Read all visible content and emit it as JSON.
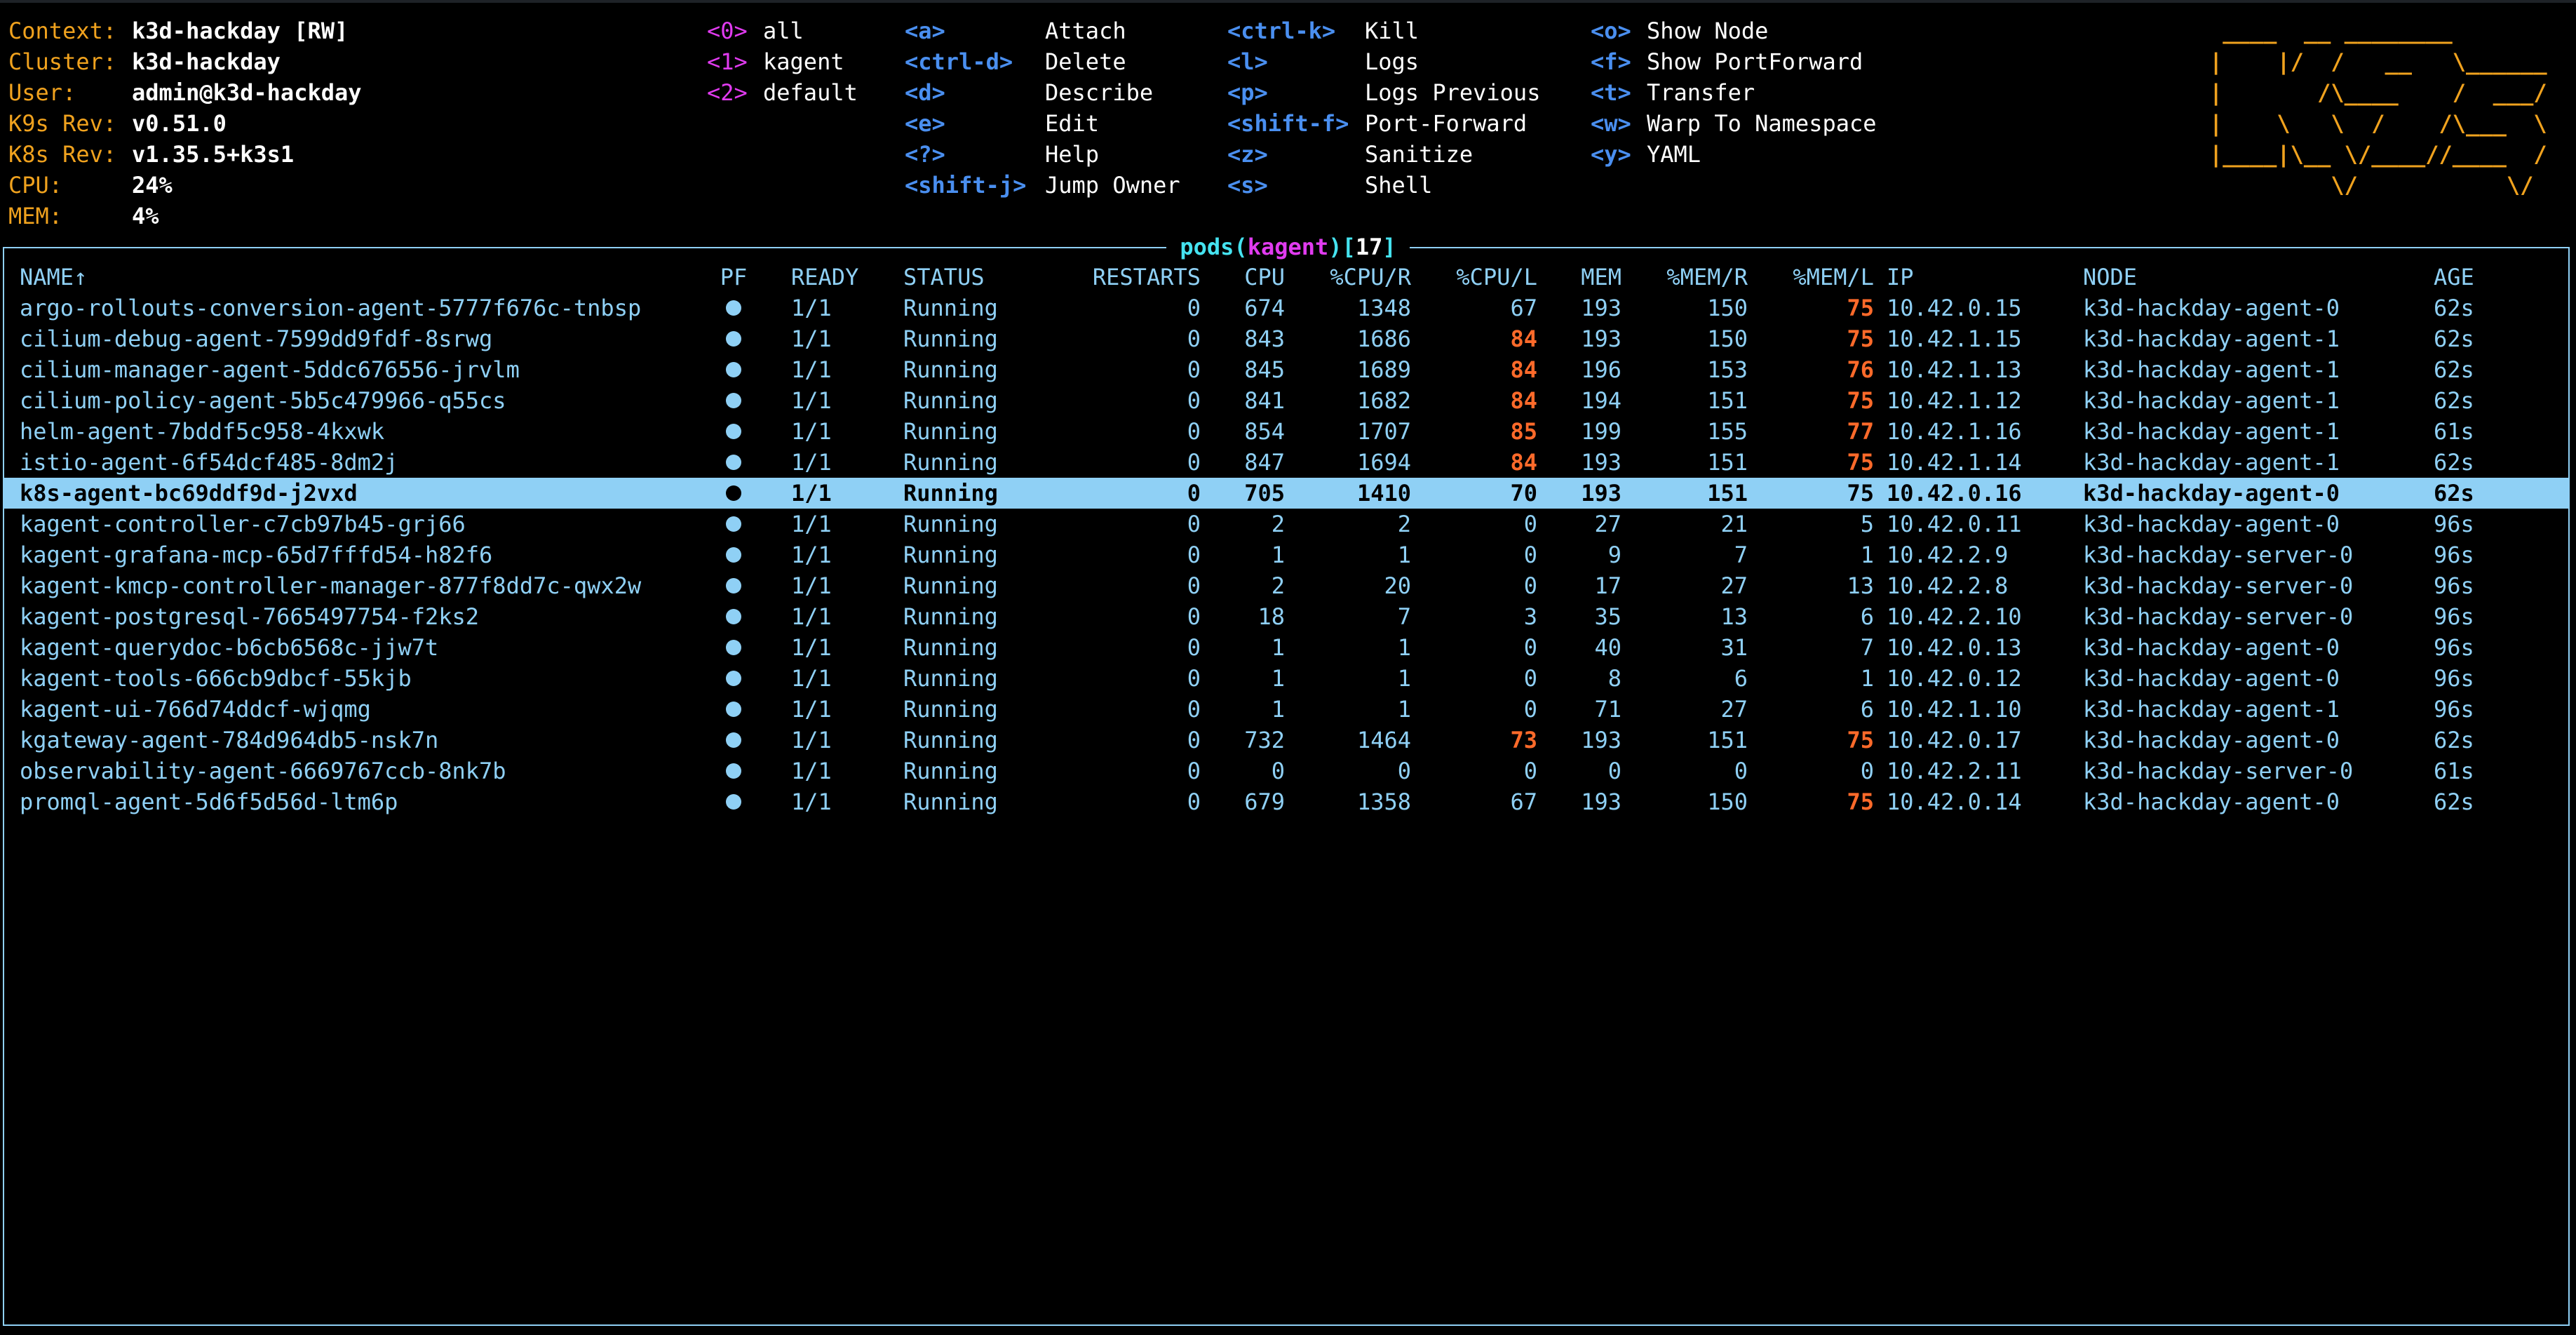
{
  "info": [
    {
      "label": "Context:",
      "value": "k3d-hackday [RW]"
    },
    {
      "label": "Cluster:",
      "value": "k3d-hackday"
    },
    {
      "label": "User:",
      "value": "admin@k3d-hackday"
    },
    {
      "label": "K9s Rev:",
      "value": "v0.51.0"
    },
    {
      "label": "K8s Rev:",
      "value": "v1.35.5+k3s1"
    },
    {
      "label": "CPU:",
      "value": "24%"
    },
    {
      "label": "MEM:",
      "value": "4%"
    }
  ],
  "namespaces": [
    {
      "hint": "<0>",
      "name": "all"
    },
    {
      "hint": "<1>",
      "name": "kagent"
    },
    {
      "hint": "<2>",
      "name": "default"
    }
  ],
  "menu": {
    "col1": [
      {
        "key": "<a>",
        "action": "Attach"
      },
      {
        "key": "<ctrl-d>",
        "action": "Delete"
      },
      {
        "key": "<d>",
        "action": "Describe"
      },
      {
        "key": "<e>",
        "action": "Edit"
      },
      {
        "key": "<?>",
        "action": "Help"
      },
      {
        "key": "<shift-j>",
        "action": "Jump Owner"
      }
    ],
    "col2": [
      {
        "key": "<ctrl-k>",
        "action": "Kill"
      },
      {
        "key": "<l>",
        "action": "Logs"
      },
      {
        "key": "<p>",
        "action": "Logs Previous"
      },
      {
        "key": "<shift-f>",
        "action": "Port-Forward"
      },
      {
        "key": "<z>",
        "action": "Sanitize"
      },
      {
        "key": "<s>",
        "action": "Shell"
      }
    ],
    "col3": [
      {
        "key": "<o>",
        "action": "Show Node"
      },
      {
        "key": "<f>",
        "action": "Show PortForward"
      },
      {
        "key": "<t>",
        "action": "Transfer"
      },
      {
        "key": "<w>",
        "action": "Warp To Namespace"
      },
      {
        "key": "<y>",
        "action": "YAML"
      }
    ]
  },
  "logo": " ____  __ ________        \n|    |/  /   __   \\______ \n|       /\\____    /  ___/ \n|    \\   \\  /    /\\___  \\ \n|____|\\__ \\/____//____  / \n         \\/           \\/  ",
  "view": {
    "resource": "pods",
    "namespace": "kagent",
    "count": "17"
  },
  "columns": {
    "name": "NAME",
    "sort_indicator": "↑",
    "pf": "PF",
    "ready": "READY",
    "status": "STATUS",
    "restarts": "RESTARTS",
    "cpu": "CPU",
    "cpu_r": "%CPU/R",
    "cpu_l": "%CPU/L",
    "mem": "MEM",
    "mem_r": "%MEM/R",
    "mem_l": "%MEM/L",
    "ip": "IP",
    "node": "NODE",
    "age": "AGE"
  },
  "pods": [
    {
      "name": "argo-rollouts-conversion-agent-5777f676c-tnbsp",
      "ready": "1/1",
      "status": "Running",
      "restarts": "0",
      "cpu": "674",
      "cpu_r": "1348",
      "cpu_l": "67",
      "mem": "193",
      "mem_r": "150",
      "mem_l": "75",
      "ip": "10.42.0.15",
      "node": "k3d-hackday-agent-0",
      "age": "62s",
      "cpu_l_hot": false,
      "mem_l_hot": true
    },
    {
      "name": "cilium-debug-agent-7599dd9fdf-8srwg",
      "ready": "1/1",
      "status": "Running",
      "restarts": "0",
      "cpu": "843",
      "cpu_r": "1686",
      "cpu_l": "84",
      "mem": "193",
      "mem_r": "150",
      "mem_l": "75",
      "ip": "10.42.1.15",
      "node": "k3d-hackday-agent-1",
      "age": "62s",
      "cpu_l_hot": true,
      "mem_l_hot": true
    },
    {
      "name": "cilium-manager-agent-5ddc676556-jrvlm",
      "ready": "1/1",
      "status": "Running",
      "restarts": "0",
      "cpu": "845",
      "cpu_r": "1689",
      "cpu_l": "84",
      "mem": "196",
      "mem_r": "153",
      "mem_l": "76",
      "ip": "10.42.1.13",
      "node": "k3d-hackday-agent-1",
      "age": "62s",
      "cpu_l_hot": true,
      "mem_l_hot": true
    },
    {
      "name": "cilium-policy-agent-5b5c479966-q55cs",
      "ready": "1/1",
      "status": "Running",
      "restarts": "0",
      "cpu": "841",
      "cpu_r": "1682",
      "cpu_l": "84",
      "mem": "194",
      "mem_r": "151",
      "mem_l": "75",
      "ip": "10.42.1.12",
      "node": "k3d-hackday-agent-1",
      "age": "62s",
      "cpu_l_hot": true,
      "mem_l_hot": true
    },
    {
      "name": "helm-agent-7bddf5c958-4kxwk",
      "ready": "1/1",
      "status": "Running",
      "restarts": "0",
      "cpu": "854",
      "cpu_r": "1707",
      "cpu_l": "85",
      "mem": "199",
      "mem_r": "155",
      "mem_l": "77",
      "ip": "10.42.1.16",
      "node": "k3d-hackday-agent-1",
      "age": "61s",
      "cpu_l_hot": true,
      "mem_l_hot": true
    },
    {
      "name": "istio-agent-6f54dcf485-8dm2j",
      "ready": "1/1",
      "status": "Running",
      "restarts": "0",
      "cpu": "847",
      "cpu_r": "1694",
      "cpu_l": "84",
      "mem": "193",
      "mem_r": "151",
      "mem_l": "75",
      "ip": "10.42.1.14",
      "node": "k3d-hackday-agent-1",
      "age": "62s",
      "cpu_l_hot": true,
      "mem_l_hot": true
    },
    {
      "name": "k8s-agent-bc69ddf9d-j2vxd",
      "ready": "1/1",
      "status": "Running",
      "restarts": "0",
      "cpu": "705",
      "cpu_r": "1410",
      "cpu_l": "70",
      "mem": "193",
      "mem_r": "151",
      "mem_l": "75",
      "ip": "10.42.0.16",
      "node": "k3d-hackday-agent-0",
      "age": "62s",
      "cpu_l_hot": false,
      "mem_l_hot": false,
      "selected": true
    },
    {
      "name": "kagent-controller-c7cb97b45-grj66",
      "ready": "1/1",
      "status": "Running",
      "restarts": "0",
      "cpu": "2",
      "cpu_r": "2",
      "cpu_l": "0",
      "mem": "27",
      "mem_r": "21",
      "mem_l": "5",
      "ip": "10.42.0.11",
      "node": "k3d-hackday-agent-0",
      "age": "96s",
      "cpu_l_hot": false,
      "mem_l_hot": false
    },
    {
      "name": "kagent-grafana-mcp-65d7fffd54-h82f6",
      "ready": "1/1",
      "status": "Running",
      "restarts": "0",
      "cpu": "1",
      "cpu_r": "1",
      "cpu_l": "0",
      "mem": "9",
      "mem_r": "7",
      "mem_l": "1",
      "ip": "10.42.2.9",
      "node": "k3d-hackday-server-0",
      "age": "96s",
      "cpu_l_hot": false,
      "mem_l_hot": false
    },
    {
      "name": "kagent-kmcp-controller-manager-877f8dd7c-qwx2w",
      "ready": "1/1",
      "status": "Running",
      "restarts": "0",
      "cpu": "2",
      "cpu_r": "20",
      "cpu_l": "0",
      "mem": "17",
      "mem_r": "27",
      "mem_l": "13",
      "ip": "10.42.2.8",
      "node": "k3d-hackday-server-0",
      "age": "96s",
      "cpu_l_hot": false,
      "mem_l_hot": false
    },
    {
      "name": "kagent-postgresql-7665497754-f2ks2",
      "ready": "1/1",
      "status": "Running",
      "restarts": "0",
      "cpu": "18",
      "cpu_r": "7",
      "cpu_l": "3",
      "mem": "35",
      "mem_r": "13",
      "mem_l": "6",
      "ip": "10.42.2.10",
      "node": "k3d-hackday-server-0",
      "age": "96s",
      "cpu_l_hot": false,
      "mem_l_hot": false
    },
    {
      "name": "kagent-querydoc-b6cb6568c-jjw7t",
      "ready": "1/1",
      "status": "Running",
      "restarts": "0",
      "cpu": "1",
      "cpu_r": "1",
      "cpu_l": "0",
      "mem": "40",
      "mem_r": "31",
      "mem_l": "7",
      "ip": "10.42.0.13",
      "node": "k3d-hackday-agent-0",
      "age": "96s",
      "cpu_l_hot": false,
      "mem_l_hot": false
    },
    {
      "name": "kagent-tools-666cb9dbcf-55kjb",
      "ready": "1/1",
      "status": "Running",
      "restarts": "0",
      "cpu": "1",
      "cpu_r": "1",
      "cpu_l": "0",
      "mem": "8",
      "mem_r": "6",
      "mem_l": "1",
      "ip": "10.42.0.12",
      "node": "k3d-hackday-agent-0",
      "age": "96s",
      "cpu_l_hot": false,
      "mem_l_hot": false
    },
    {
      "name": "kagent-ui-766d74ddcf-wjqmg",
      "ready": "1/1",
      "status": "Running",
      "restarts": "0",
      "cpu": "1",
      "cpu_r": "1",
      "cpu_l": "0",
      "mem": "71",
      "mem_r": "27",
      "mem_l": "6",
      "ip": "10.42.1.10",
      "node": "k3d-hackday-agent-1",
      "age": "96s",
      "cpu_l_hot": false,
      "mem_l_hot": false
    },
    {
      "name": "kgateway-agent-784d964db5-nsk7n",
      "ready": "1/1",
      "status": "Running",
      "restarts": "0",
      "cpu": "732",
      "cpu_r": "1464",
      "cpu_l": "73",
      "mem": "193",
      "mem_r": "151",
      "mem_l": "75",
      "ip": "10.42.0.17",
      "node": "k3d-hackday-agent-0",
      "age": "62s",
      "cpu_l_hot": true,
      "mem_l_hot": true
    },
    {
      "name": "observability-agent-6669767ccb-8nk7b",
      "ready": "1/1",
      "status": "Running",
      "restarts": "0",
      "cpu": "0",
      "cpu_r": "0",
      "cpu_l": "0",
      "mem": "0",
      "mem_r": "0",
      "mem_l": "0",
      "ip": "10.42.2.11",
      "node": "k3d-hackday-server-0",
      "age": "61s",
      "cpu_l_hot": false,
      "mem_l_hot": false
    },
    {
      "name": "promql-agent-5d6f5d56d-ltm6p",
      "ready": "1/1",
      "status": "Running",
      "restarts": "0",
      "cpu": "679",
      "cpu_r": "1358",
      "cpu_l": "67",
      "mem": "193",
      "mem_r": "150",
      "mem_l": "75",
      "ip": "10.42.0.14",
      "node": "k3d-hackday-agent-0",
      "age": "62s",
      "cpu_l_hot": false,
      "mem_l_hot": true
    }
  ],
  "colors": {
    "background": "#000000",
    "frame": "#8fd0f5",
    "label": "#f0a21e",
    "key": "#4a8ff0",
    "hint": "#e13bf0",
    "hot": "#ff6a2a",
    "selection": "#8fd0f5"
  }
}
